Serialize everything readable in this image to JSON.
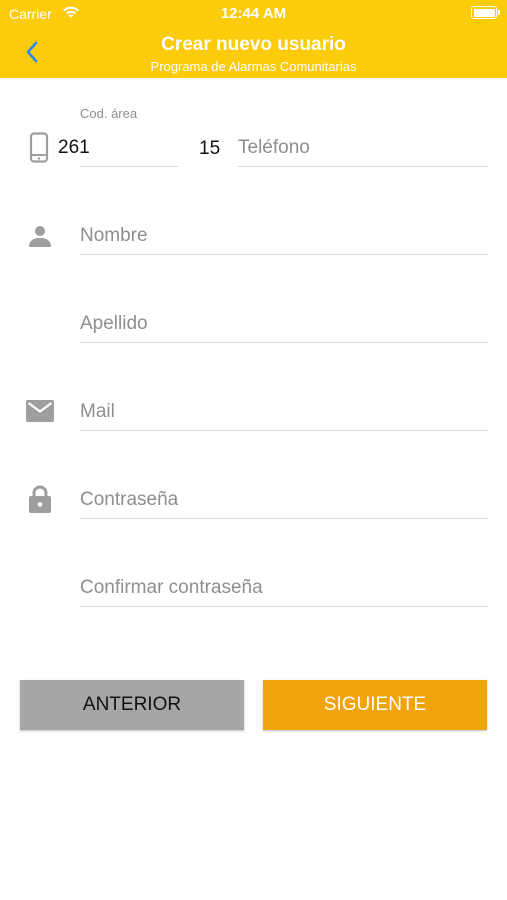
{
  "status_bar": {
    "carrier": "Carrier",
    "time": "12:44 AM"
  },
  "header": {
    "title": "Crear nuevo usuario",
    "subtitle": "Programa de Alarmas Comunitarias",
    "back_icon": "chevron-left-icon"
  },
  "form": {
    "area_code": {
      "caption": "Cod. área",
      "value": "261"
    },
    "phone_prefix": "15",
    "phone": {
      "placeholder": "Teléfono",
      "value": ""
    },
    "first_name": {
      "placeholder": "Nombre",
      "value": ""
    },
    "last_name": {
      "placeholder": "Apellido",
      "value": ""
    },
    "email": {
      "placeholder": "Mail",
      "value": ""
    },
    "password": {
      "placeholder": "Contraseña",
      "value": ""
    },
    "confirm_password": {
      "placeholder": "Confirmar contraseña",
      "value": ""
    }
  },
  "buttons": {
    "previous": "ANTERIOR",
    "next": "SIGUIENTE"
  },
  "colors": {
    "header_bg": "#fccb0b",
    "back_arrow": "#2a86ff",
    "next_button": "#f0a30a",
    "previous_button": "#a6a6a6",
    "icon_gray": "#9e9e9e"
  }
}
